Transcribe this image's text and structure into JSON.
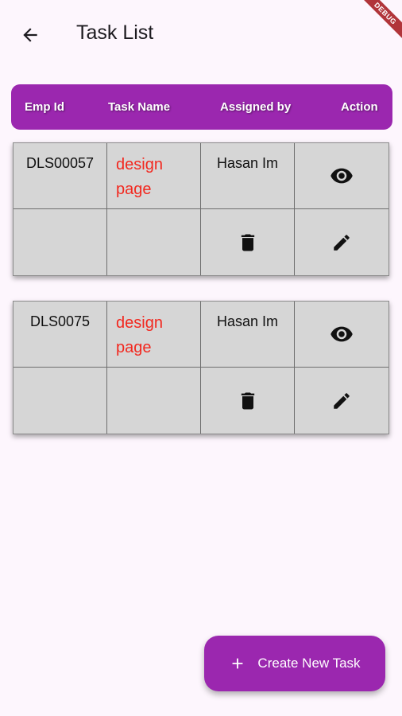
{
  "appbar": {
    "title": "Task List"
  },
  "debug_banner": "DEBUG",
  "table_header": {
    "emp_id": "Emp Id",
    "task_name": "Task Name",
    "assigned_by": "Assigned by",
    "action": "Action"
  },
  "tasks": [
    {
      "emp_id": "DLS00057",
      "task_name": "design page",
      "assigned_by": "Hasan Im"
    },
    {
      "emp_id": "DLS0075",
      "task_name": "design page",
      "assigned_by": "Hasan Im"
    }
  ],
  "fab": {
    "label": "Create New Task"
  },
  "colors": {
    "accent": "#9b27af",
    "task_text": "#f2281f",
    "card_bg": "#d6d6d6",
    "page_bg": "#fdf6fd"
  },
  "icons": {
    "back": "arrow-left-icon",
    "view": "eye-icon",
    "delete": "trash-icon",
    "edit": "pencil-icon",
    "add": "plus-icon"
  }
}
